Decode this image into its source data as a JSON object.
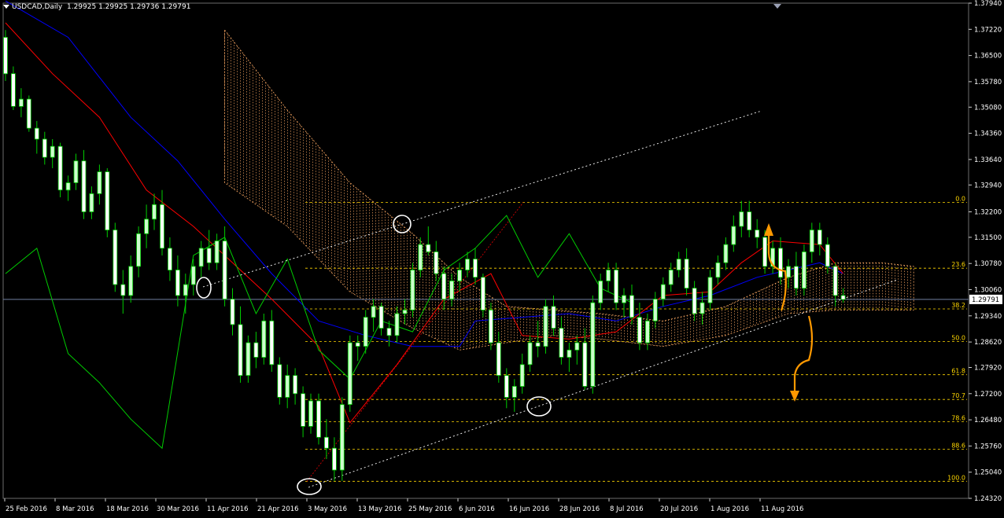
{
  "header": {
    "symbol": "USDCAD,Daily",
    "ohlc": "1.29925 1.29925 1.29736 1.29791"
  },
  "colors": {
    "background": "#000000",
    "candle_up": "#ccffcc",
    "candle_down": "#ffffff",
    "candle_outline": "#00cc00",
    "tenkan": "#ff0000",
    "kijun": "#0000ff",
    "chikou": "#00cc00",
    "cloud": "#f4a460",
    "fib": "#ffd700",
    "trendline": "#ffffff",
    "arrow": "#ff9900",
    "bid_line": "#6f7fa0"
  },
  "chart_data": {
    "type": "candlestick",
    "x_tick_labels": [
      "25 Feb 2016",
      "8 Mar 2016",
      "18 Mar 2016",
      "30 Mar 2016",
      "11 Apr 2016",
      "21 Apr 2016",
      "3 May 2016",
      "13 May 2016",
      "25 May 2016",
      "6 Jun 2016",
      "16 Jun 2016",
      "28 Jun 2016",
      "8 Jul 2016",
      "20 Jul 2016",
      "1 Aug 2016",
      "11 Aug 2016"
    ],
    "y_tick_labels": [
      "1.37940",
      "1.37220",
      "1.36500",
      "1.35780",
      "1.35080",
      "1.34360",
      "1.33640",
      "1.32940",
      "1.32200",
      "1.31500",
      "1.30780",
      "1.30060",
      "1.29340",
      "1.28620",
      "1.27920",
      "1.27200",
      "1.26480",
      "1.25760",
      "1.25040",
      "1.24320"
    ],
    "ylim": [
      1.2432,
      1.3794
    ],
    "current_price": "1.29791",
    "fib_levels": [
      {
        "label": "0.0",
        "price": 1.3246
      },
      {
        "label": "23.6",
        "price": 1.3065
      },
      {
        "label": "38.2",
        "price": 1.2953
      },
      {
        "label": "50.0",
        "price": 1.2863
      },
      {
        "label": "61.8",
        "price": 1.2772
      },
      {
        "label": "70.7",
        "price": 1.2704
      },
      {
        "label": "78.6",
        "price": 1.2643
      },
      {
        "label": "88.6",
        "price": 1.2567
      },
      {
        "label": "100.0",
        "price": 1.2479
      }
    ],
    "candles": [
      [
        1.37,
        1.372,
        1.358,
        1.36
      ],
      [
        1.36,
        1.362,
        1.35,
        1.351
      ],
      [
        1.351,
        1.356,
        1.348,
        1.353
      ],
      [
        1.353,
        1.354,
        1.344,
        1.345
      ],
      [
        1.345,
        1.347,
        1.338,
        1.342
      ],
      [
        1.342,
        1.344,
        1.335,
        1.337
      ],
      [
        1.337,
        1.342,
        1.334,
        1.34
      ],
      [
        1.34,
        1.341,
        1.326,
        1.328
      ],
      [
        1.328,
        1.332,
        1.325,
        1.33
      ],
      [
        1.33,
        1.338,
        1.328,
        1.336
      ],
      [
        1.336,
        1.339,
        1.32,
        1.322
      ],
      [
        1.322,
        1.329,
        1.32,
        1.327
      ],
      [
        1.327,
        1.335,
        1.324,
        1.333
      ],
      [
        1.333,
        1.334,
        1.315,
        1.317
      ],
      [
        1.317,
        1.319,
        1.3,
        1.302
      ],
      [
        1.302,
        1.306,
        1.294,
        1.299
      ],
      [
        1.299,
        1.31,
        1.297,
        1.307
      ],
      [
        1.307,
        1.318,
        1.304,
        1.316
      ],
      [
        1.316,
        1.324,
        1.312,
        1.32
      ],
      [
        1.32,
        1.327,
        1.317,
        1.324
      ],
      [
        1.324,
        1.328,
        1.31,
        1.312
      ],
      [
        1.312,
        1.315,
        1.303,
        1.306
      ],
      [
        1.306,
        1.31,
        1.296,
        1.299
      ],
      [
        1.299,
        1.305,
        1.294,
        1.302
      ],
      [
        1.302,
        1.309,
        1.299,
        1.307
      ],
      [
        1.307,
        1.314,
        1.304,
        1.312
      ],
      [
        1.312,
        1.317,
        1.306,
        1.308
      ],
      [
        1.308,
        1.316,
        1.306,
        1.314
      ],
      [
        1.314,
        1.318,
        1.296,
        1.298
      ],
      [
        1.298,
        1.301,
        1.288,
        1.291
      ],
      [
        1.291,
        1.296,
        1.275,
        1.277
      ],
      [
        1.277,
        1.288,
        1.275,
        1.286
      ],
      [
        1.286,
        1.289,
        1.279,
        1.282
      ],
      [
        1.282,
        1.294,
        1.28,
        1.292
      ],
      [
        1.292,
        1.295,
        1.278,
        1.28
      ],
      [
        1.28,
        1.282,
        1.269,
        1.271
      ],
      [
        1.271,
        1.28,
        1.268,
        1.277
      ],
      [
        1.277,
        1.279,
        1.269,
        1.272
      ],
      [
        1.272,
        1.274,
        1.26,
        1.263
      ],
      [
        1.263,
        1.272,
        1.261,
        1.27
      ],
      [
        1.27,
        1.272,
        1.258,
        1.26
      ],
      [
        1.26,
        1.265,
        1.254,
        1.257
      ],
      [
        1.257,
        1.26,
        1.248,
        1.251
      ],
      [
        1.251,
        1.271,
        1.248,
        1.269
      ],
      [
        1.269,
        1.288,
        1.267,
        1.286
      ],
      [
        1.286,
        1.288,
        1.281,
        1.285
      ],
      [
        1.285,
        1.295,
        1.283,
        1.293
      ],
      [
        1.293,
        1.298,
        1.289,
        1.296
      ],
      [
        1.296,
        1.297,
        1.288,
        1.29
      ],
      [
        1.29,
        1.292,
        1.285,
        1.288
      ],
      [
        1.288,
        1.296,
        1.286,
        1.294
      ],
      [
        1.294,
        1.298,
        1.291,
        1.295
      ],
      [
        1.295,
        1.308,
        1.293,
        1.306
      ],
      [
        1.306,
        1.315,
        1.304,
        1.313
      ],
      [
        1.313,
        1.318,
        1.31,
        1.311
      ],
      [
        1.311,
        1.314,
        1.303,
        1.305
      ],
      [
        1.305,
        1.307,
        1.295,
        1.298
      ],
      [
        1.298,
        1.305,
        1.296,
        1.303
      ],
      [
        1.303,
        1.308,
        1.3,
        1.306
      ],
      [
        1.306,
        1.311,
        1.304,
        1.309
      ],
      [
        1.309,
        1.312,
        1.302,
        1.304
      ],
      [
        1.304,
        1.305,
        1.293,
        1.295
      ],
      [
        1.295,
        1.297,
        1.284,
        1.286
      ],
      [
        1.286,
        1.289,
        1.275,
        1.277
      ],
      [
        1.277,
        1.279,
        1.268,
        1.271
      ],
      [
        1.271,
        1.276,
        1.267,
        1.274
      ],
      [
        1.274,
        1.283,
        1.272,
        1.28
      ],
      [
        1.28,
        1.288,
        1.278,
        1.286
      ],
      [
        1.286,
        1.292,
        1.282,
        1.285
      ],
      [
        1.285,
        1.298,
        1.283,
        1.296
      ],
      [
        1.296,
        1.299,
        1.288,
        1.29
      ],
      [
        1.29,
        1.293,
        1.28,
        1.282
      ],
      [
        1.282,
        1.286,
        1.278,
        1.284
      ],
      [
        1.284,
        1.288,
        1.28,
        1.286
      ],
      [
        1.286,
        1.29,
        1.273,
        1.274
      ],
      [
        1.274,
        1.299,
        1.272,
        1.297
      ],
      [
        1.297,
        1.305,
        1.295,
        1.303
      ],
      [
        1.303,
        1.308,
        1.3,
        1.306
      ],
      [
        1.306,
        1.308,
        1.295,
        1.297
      ],
      [
        1.297,
        1.301,
        1.293,
        1.299
      ],
      [
        1.299,
        1.302,
        1.291,
        1.293
      ],
      [
        1.293,
        1.297,
        1.284,
        1.286
      ],
      [
        1.286,
        1.294,
        1.284,
        1.292
      ],
      [
        1.292,
        1.3,
        1.29,
        1.298
      ],
      [
        1.298,
        1.304,
        1.296,
        1.302
      ],
      [
        1.302,
        1.308,
        1.3,
        1.306
      ],
      [
        1.306,
        1.311,
        1.304,
        1.309
      ],
      [
        1.309,
        1.312,
        1.299,
        1.301
      ],
      [
        1.301,
        1.303,
        1.292,
        1.294
      ],
      [
        1.294,
        1.3,
        1.291,
        1.297
      ],
      [
        1.297,
        1.306,
        1.295,
        1.304
      ],
      [
        1.304,
        1.31,
        1.302,
        1.308
      ],
      [
        1.308,
        1.315,
        1.306,
        1.313
      ],
      [
        1.313,
        1.321,
        1.311,
        1.318
      ],
      [
        1.318,
        1.325,
        1.315,
        1.322
      ],
      [
        1.322,
        1.325,
        1.315,
        1.317
      ],
      [
        1.317,
        1.32,
        1.312,
        1.315
      ],
      [
        1.315,
        1.317,
        1.305,
        1.307
      ],
      [
        1.307,
        1.314,
        1.305,
        1.312
      ],
      [
        1.312,
        1.315,
        1.302,
        1.304
      ],
      [
        1.304,
        1.309,
        1.301,
        1.307
      ],
      [
        1.307,
        1.311,
        1.299,
        1.301
      ],
      [
        1.301,
        1.313,
        1.299,
        1.311
      ],
      [
        1.311,
        1.319,
        1.308,
        1.317
      ],
      [
        1.317,
        1.319,
        1.31,
        1.313
      ],
      [
        1.313,
        1.315,
        1.305,
        1.307
      ],
      [
        1.307,
        1.308,
        1.296,
        1.299
      ],
      [
        1.299,
        1.301,
        1.297,
        1.2979
      ]
    ],
    "tenkan": [
      [
        0,
        1.374
      ],
      [
        6,
        1.36
      ],
      [
        12,
        1.348
      ],
      [
        18,
        1.328
      ],
      [
        24,
        1.318
      ],
      [
        28,
        1.31
      ],
      [
        34,
        1.298
      ],
      [
        40,
        1.285
      ],
      [
        44,
        1.264
      ],
      [
        50,
        1.28
      ],
      [
        56,
        1.298
      ],
      [
        62,
        1.305
      ],
      [
        66,
        1.288
      ],
      [
        72,
        1.287
      ],
      [
        78,
        1.289
      ],
      [
        84,
        1.299
      ],
      [
        90,
        1.3
      ],
      [
        94,
        1.308
      ],
      [
        98,
        1.314
      ],
      [
        104,
        1.313
      ],
      [
        107,
        1.305
      ]
    ],
    "kijun": [
      [
        0,
        1.38
      ],
      [
        8,
        1.37
      ],
      [
        16,
        1.348
      ],
      [
        22,
        1.336
      ],
      [
        28,
        1.32
      ],
      [
        34,
        1.305
      ],
      [
        40,
        1.292
      ],
      [
        46,
        1.288
      ],
      [
        52,
        1.285
      ],
      [
        58,
        1.285
      ],
      [
        60,
        1.292
      ],
      [
        66,
        1.293
      ],
      [
        72,
        1.294
      ],
      [
        78,
        1.292
      ],
      [
        84,
        1.296
      ],
      [
        90,
        1.299
      ],
      [
        96,
        1.304
      ],
      [
        100,
        1.306
      ],
      [
        104,
        1.308
      ],
      [
        107,
        1.305
      ]
    ],
    "chikou": [
      [
        0,
        1.305
      ],
      [
        4,
        1.312
      ],
      [
        8,
        1.283
      ],
      [
        12,
        1.275
      ],
      [
        16,
        1.265
      ],
      [
        20,
        1.257
      ],
      [
        24,
        1.31
      ],
      [
        28,
        1.315
      ],
      [
        32,
        1.294
      ],
      [
        36,
        1.309
      ],
      [
        40,
        1.284
      ],
      [
        44,
        1.276
      ],
      [
        48,
        1.292
      ],
      [
        52,
        1.289
      ],
      [
        56,
        1.306
      ],
      [
        60,
        1.312
      ],
      [
        64,
        1.321
      ],
      [
        68,
        1.304
      ],
      [
        72,
        1.316
      ],
      [
        76,
        1.301
      ],
      [
        80,
        1.297
      ]
    ],
    "cloud_upper": [
      [
        28,
        1.372
      ],
      [
        36,
        1.35
      ],
      [
        44,
        1.33
      ],
      [
        52,
        1.316
      ],
      [
        58,
        1.304
      ],
      [
        64,
        1.296
      ],
      [
        70,
        1.295
      ],
      [
        76,
        1.294
      ],
      [
        84,
        1.292
      ],
      [
        92,
        1.296
      ],
      [
        100,
        1.304
      ],
      [
        106,
        1.308
      ],
      [
        112,
        1.308
      ],
      [
        116,
        1.307
      ]
    ],
    "cloud_lower": [
      [
        28,
        1.33
      ],
      [
        36,
        1.318
      ],
      [
        44,
        1.3
      ],
      [
        52,
        1.29
      ],
      [
        58,
        1.284
      ],
      [
        64,
        1.286
      ],
      [
        70,
        1.288
      ],
      [
        76,
        1.287
      ],
      [
        84,
        1.285
      ],
      [
        92,
        1.288
      ],
      [
        100,
        1.294
      ],
      [
        106,
        1.295
      ],
      [
        112,
        1.295
      ],
      [
        116,
        1.295
      ]
    ]
  }
}
